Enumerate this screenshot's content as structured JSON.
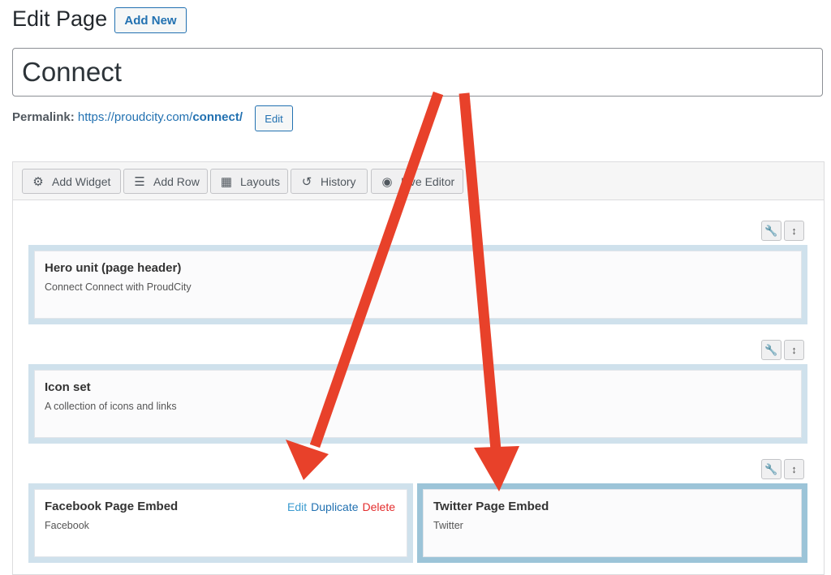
{
  "header": {
    "title": "Edit Page",
    "add_new": "Add New"
  },
  "title_input": {
    "value": "Connect"
  },
  "permalink": {
    "label": "Permalink:",
    "url_base": "https://proudcity.com/",
    "slug": "connect/",
    "edit": "Edit"
  },
  "toolbar": {
    "buttons": [
      {
        "label": "Add Widget",
        "icon": "gear-icon"
      },
      {
        "label": "Add Row",
        "icon": "menu-icon"
      },
      {
        "label": "Layouts",
        "icon": "layout-icon"
      },
      {
        "label": "History",
        "icon": "history-icon"
      },
      {
        "label": "Live Editor",
        "icon": "eye-icon"
      }
    ]
  },
  "rows": [
    {
      "widgets": [
        {
          "title": "Hero unit (page header)",
          "desc": "Connect Connect with ProudCity"
        }
      ]
    },
    {
      "widgets": [
        {
          "title": "Icon set",
          "desc": "A collection of icons and links"
        }
      ]
    },
    {
      "widgets": [
        {
          "title": "Facebook Page Embed",
          "desc": "Facebook",
          "actions": {
            "edit": "Edit",
            "duplicate": "Duplicate",
            "delete": "Delete"
          }
        },
        {
          "title": "Twitter Page Embed",
          "desc": "Twitter",
          "selected": true
        }
      ]
    }
  ],
  "colors": {
    "accent": "#2271b1",
    "delete": "#e32d2d",
    "arrow": "#e8412a",
    "widget_border": "#cfe1ec",
    "widget_selected": "#9cc4d8"
  }
}
